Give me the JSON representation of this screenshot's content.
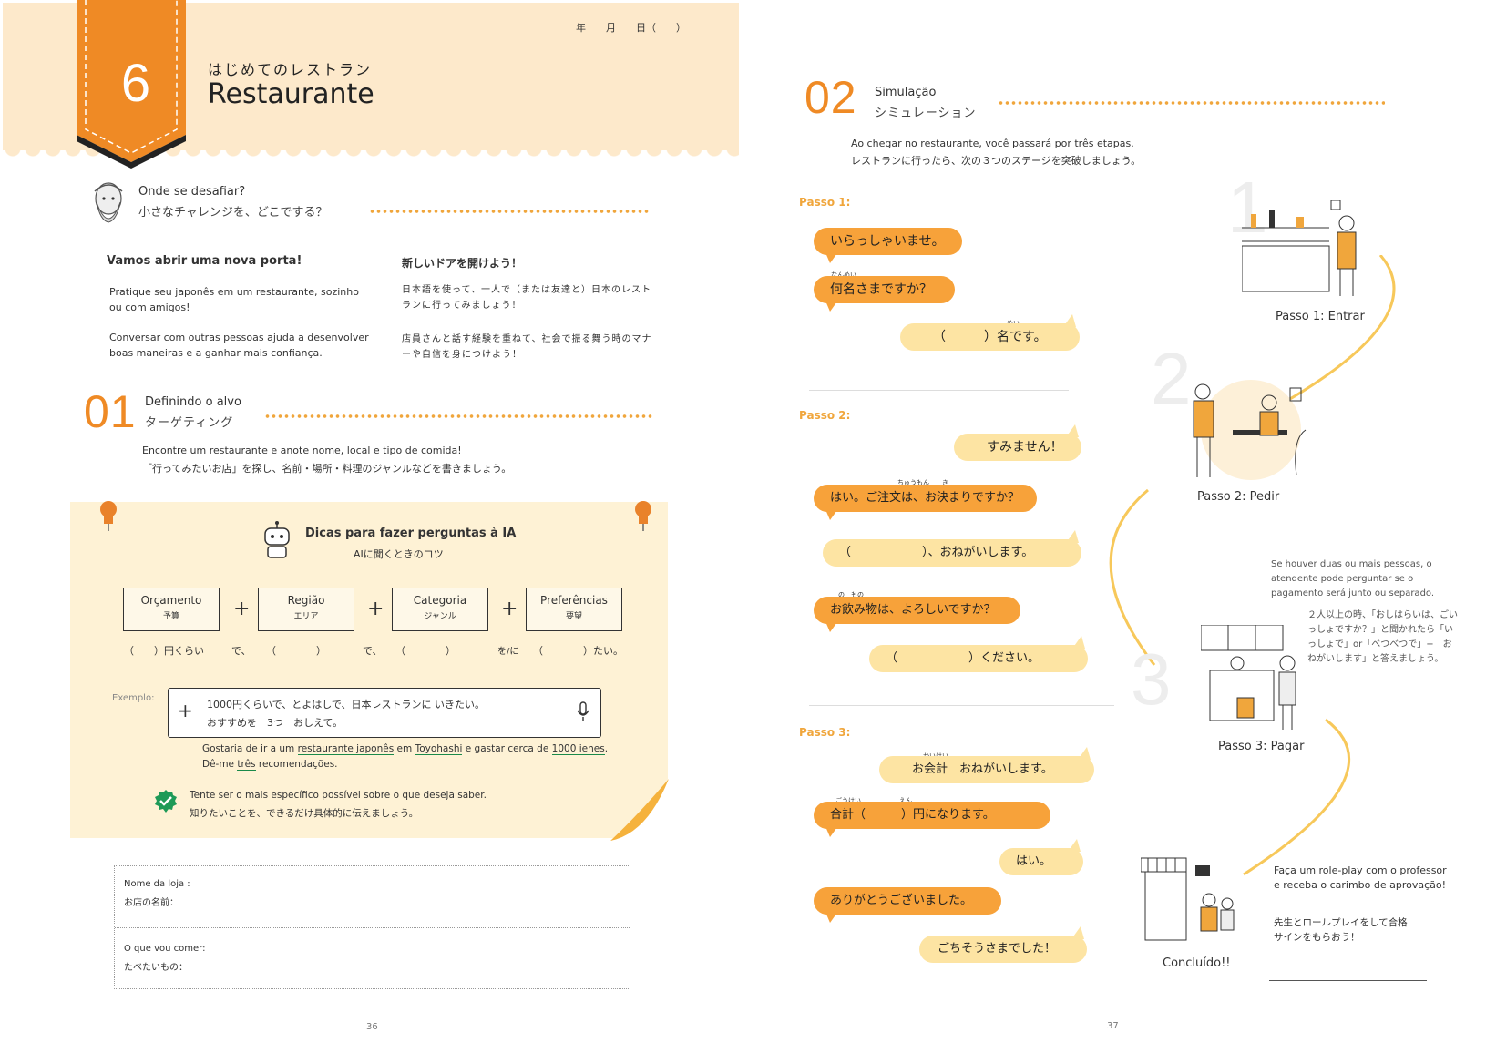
{
  "left": {
    "header": {
      "chapter_number": "6",
      "title_jp": "はじめてのレストラン",
      "title": "Restaurante",
      "date_line": "年　　月　　日（　　）"
    },
    "challenge": {
      "heading": "Onde se desafiar?",
      "heading_jp": "小さなチャレンジを、どこでする？",
      "col_pt_title": "Vamos abrir uma nova porta!",
      "col_pt_p1": "Pratique seu japonês em um restaurante, sozinho ou com amigos!",
      "col_pt_p2": "Conversar com outras pessoas ajuda a desenvolver boas maneiras e a ganhar mais confiança.",
      "col_jp_title": "新しいドアを開けよう！",
      "col_jp_p1": "日本語を使って、一人で（または友達と）日本のレストランに行ってみましょう！",
      "col_jp_p2": "店員さんと話す経験を重ねて、社会で振る舞う時のマナーや自信を身につけよう！"
    },
    "section01": {
      "number": "01",
      "title": "Definindo o alvo",
      "title_jp": "ターゲティング",
      "desc": "Encontre um restaurante e anote nome, local e tipo de comida!",
      "desc_jp": "「行ってみたいお店」を探し、名前・場所・料理のジャンルなどを書きましょう。"
    },
    "tips": {
      "title": "Dicas para fazer perguntas à IA",
      "title_jp": "AIに聞くときのコツ",
      "boxes": [
        {
          "label": "Orçamento",
          "jp": "予算"
        },
        {
          "label": "Região",
          "jp": "エリア"
        },
        {
          "label": "Categoria",
          "jp": "ジャンル"
        },
        {
          "label": "Preferências",
          "jp": "要望"
        }
      ],
      "plus": "+",
      "fill_1": "（　　）円くらい",
      "fill_2": "で、",
      "fill_3": "（　　　　）",
      "fill_4": "で、",
      "fill_5": "（　　　　）",
      "fill_6": "を/に",
      "fill_7": "（　　　　）たい。",
      "example_label": "Exemplo:",
      "example_plus": "+",
      "example_line1": "1000円くらいで、とよはしで、日本レストランに いきたい。",
      "example_line2": "おすすめを　3つ　おしえて。",
      "translation_a": "Gostaria de ir a um ",
      "translation_u1": "restaurante japonês",
      "translation_b": " em ",
      "translation_u2": "Toyohashi",
      "translation_c": " e gastar cerca de ",
      "translation_u3": "1000 ienes",
      "translation_d": ".",
      "translation_e": "Dê-me ",
      "translation_u4": "três",
      "translation_f": " recomendações.",
      "hint": "Tente ser o mais específico possível sobre o que deseja saber.",
      "hint_jp": "知りたいことを、できるだけ具体的に伝えましょう。"
    },
    "form": {
      "field1": "Nome da loja :",
      "field1_jp": "お店の名前：",
      "field2": "O que vou comer:",
      "field2_jp": "たべたいもの："
    },
    "page_number": "36"
  },
  "right": {
    "section02": {
      "number": "02",
      "title": "Simulação",
      "title_jp": "シミュレーション",
      "desc": "Ao chegar no restaurante, você passará por três etapas.",
      "desc_jp": "レストランに行ったら、次の３つのステージを突破しましょう。"
    },
    "passo1": {
      "label": "Passo 1:",
      "b1": "いらっしゃいませ。",
      "b2_ruby": "なんめい",
      "b2": "何名さまですか？",
      "b3_ruby": "めい",
      "b3": "（　　　）名です。"
    },
    "passo2": {
      "label": "Passo 2:",
      "b1": "すみません！",
      "b2_ruby": "ちゅうもん　　き",
      "b2": "はい。ご注文は、お決まりですか？",
      "b3": "（　　　　　　）、おねがいします。",
      "b4_ruby": "の　もの",
      "b4": "お飲み物は、よろしいですか？",
      "b5": "（　　　　　　）ください。"
    },
    "passo3": {
      "label": "Passo 3:",
      "b1_ruby": "かいけい",
      "b1": "お会計　おねがいします。",
      "b2_ruby": "ごうけい　　　　　　えん",
      "b2": "合計（　　　）円になります。",
      "b3": "はい。",
      "b4": "ありがとうございました。",
      "b5": "ごちそうさまでした！"
    },
    "steps": {
      "n1": "1",
      "c1": "Passo 1: Entrar",
      "n2": "2",
      "c2": "Passo 2: Pedir",
      "n3": "3",
      "c3": "Passo 3: Pagar",
      "done": "Concluído!!"
    },
    "note": {
      "pt": "Se houver duas ou mais pessoas, o atendente pode perguntar se o pagamento será junto ou separado.",
      "jp": "２人以上の時、「おしはらいは、ごいっしょですか？」と聞かれたら「いっしょで」or「べつべつで」+「おねがいします」と答えましょう。"
    },
    "roleplay": {
      "pt": "Faça um role-play com o professor e receba o carimbo de aprovação!",
      "jp": "先生とロールプレイをして合格サインをもらおう！"
    },
    "page_number": "37"
  },
  "colors": {
    "accent": "#ef8a25",
    "header_bg": "#fde9cb",
    "tips_bg": "#fef2d5",
    "bubble_orange": "#f7a23a",
    "bubble_yellow": "#fde4a3"
  }
}
